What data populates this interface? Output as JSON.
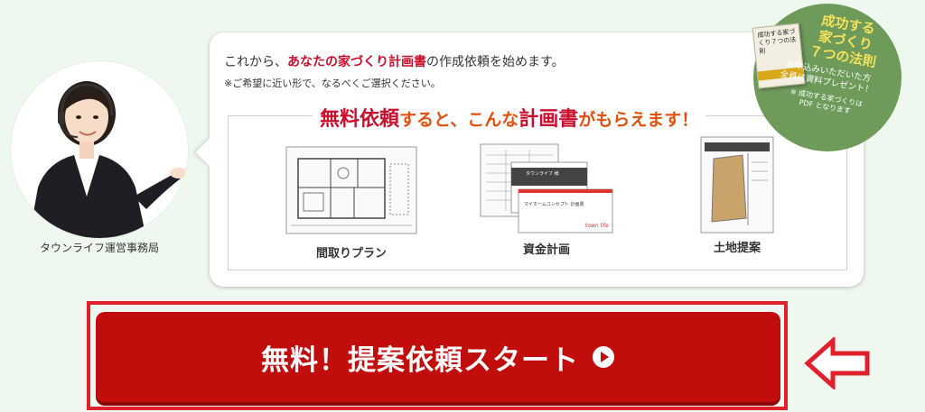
{
  "staff": {
    "label": "タウンライフ運営事務局"
  },
  "intro": {
    "prefix": "これから、",
    "emphasis": "あなたの家づくり計画書",
    "suffix": "の作成依頼を始めます。",
    "note": "※ご希望に近い形で、なるべくご選択ください。"
  },
  "headline": {
    "part1": "無料依頼",
    "part2": "すると、こんな",
    "part3": "計画書",
    "part4": "がもらえます！"
  },
  "plans": [
    {
      "label": "間取りプラン",
      "icon": "floor-plan-icon"
    },
    {
      "label": "資金計画",
      "icon": "financial-plan-icon"
    },
    {
      "label": "土地提案",
      "icon": "land-proposal-icon"
    }
  ],
  "mini_doc": {
    "title": "タウンライフ 様",
    "subtitle": "マイホームコンセプト 計画書",
    "brand": "town life"
  },
  "badge": {
    "book_text": "成功する家づくり７つの法則",
    "title_line1": "成功する",
    "title_line2": "家づくり",
    "title_line3": "７つの法則",
    "sub_line1": "お申込みいただいた方",
    "sub_line2": "全員に資料プレゼント！",
    "foot_line1": "※ 成功する家づくりは",
    "foot_line2": "PDF となります"
  },
  "cta": {
    "label": "無料！提案依頼スタート"
  },
  "colors": {
    "cta": "#c20d0d",
    "frame": "#e0202a",
    "accent": "#c8102e",
    "headline": "#e0500f",
    "badge": "#6e9a5a"
  }
}
